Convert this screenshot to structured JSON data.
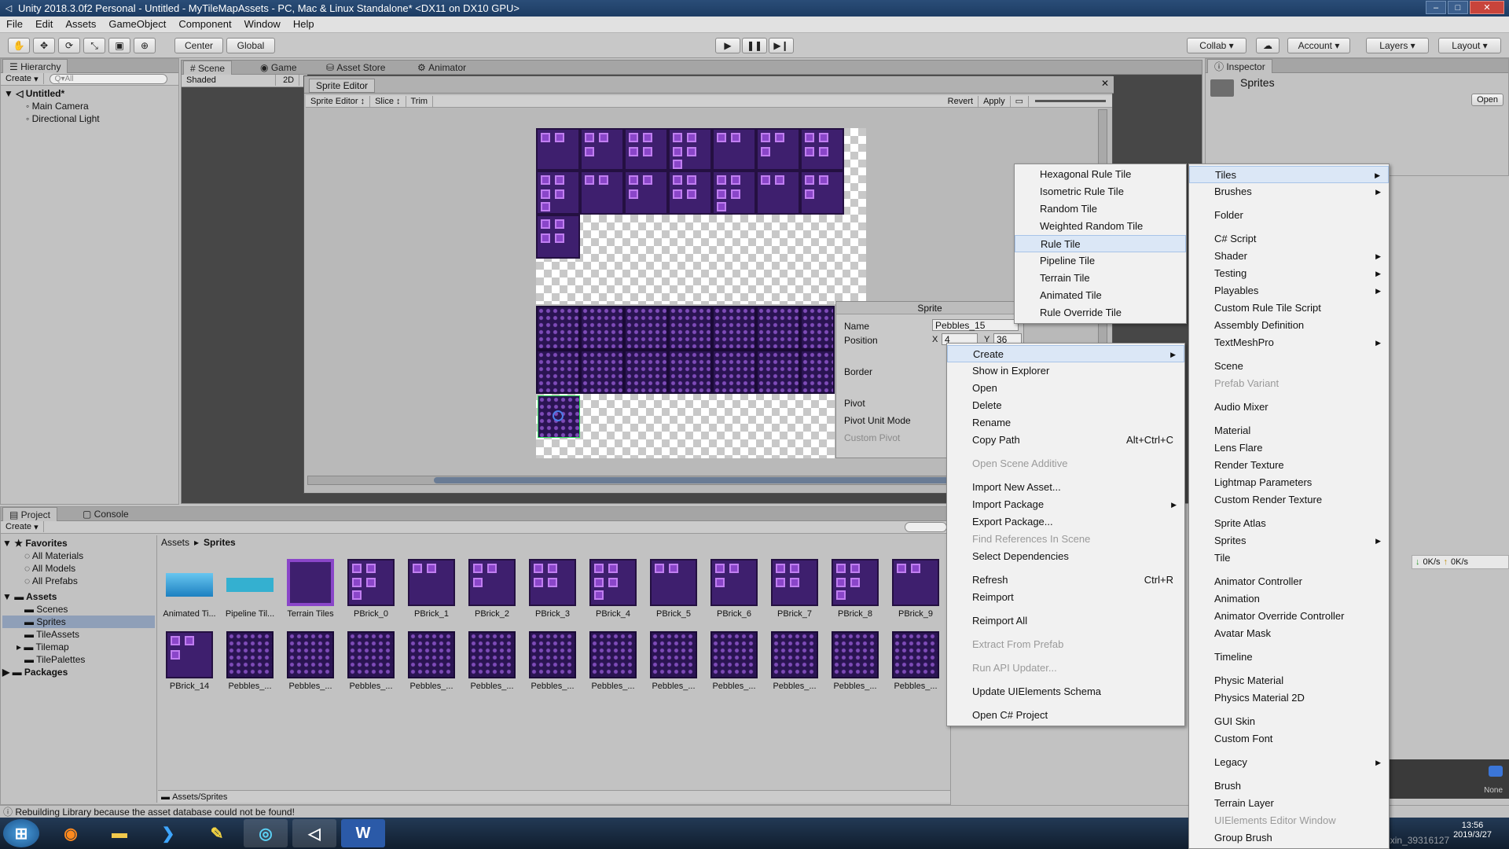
{
  "window": {
    "title": "Unity 2018.3.0f2 Personal - Untitled - MyTileMapAssets - PC, Mac & Linux Standalone* <DX11 on DX10 GPU>",
    "min": "–",
    "max": "□",
    "close": "✕"
  },
  "menubar": [
    "File",
    "Edit",
    "Assets",
    "GameObject",
    "Component",
    "Window",
    "Help"
  ],
  "toolbar": {
    "center": "Center",
    "global": "Global",
    "collab": "Collab",
    "account": "Account",
    "layers": "Layers",
    "layout": "Layout"
  },
  "hierarchy": {
    "tab": "Hierarchy",
    "create": "Create",
    "search": "Q▾All",
    "scene": "Untitled*",
    "items": [
      "Main Camera",
      "Directional Light"
    ]
  },
  "scene_tabs": [
    "Scene",
    "Game",
    "Asset Store",
    "Animator"
  ],
  "scene_bar": {
    "shaded": "Shaded",
    "mode": "2D"
  },
  "sprite_editor": {
    "title": "Sprite Editor",
    "mode": "Sprite Editor",
    "slice": "Slice",
    "trim": "Trim",
    "revert": "Revert",
    "apply": "Apply"
  },
  "sprite_panel": {
    "header": "Sprite",
    "name_label": "Name",
    "name_value": "Pebbles_15",
    "position_label": "Position",
    "x_label": "X",
    "x_value": "4",
    "y_label": "Y",
    "y_value": "36",
    "border_label": "Border",
    "pivot_label": "Pivot",
    "pivot_unit_label": "Pivot Unit Mode",
    "custom_pivot_label": "Custom Pivot"
  },
  "inspector": {
    "tab": "Inspector",
    "title": "Sprites",
    "open": "Open"
  },
  "project": {
    "tabs": [
      "Project",
      "Console"
    ],
    "create": "Create",
    "breadcrumb": [
      "Assets",
      "Sprites"
    ],
    "footer": "Assets/Sprites",
    "favorites": {
      "label": "Favorites",
      "items": [
        "All Materials",
        "All Models",
        "All Prefabs"
      ]
    },
    "assets": {
      "label": "Assets",
      "items": [
        "Scenes",
        "Sprites",
        "TileAssets",
        "Tilemap",
        "TilePalettes"
      ]
    },
    "packages": "Packages",
    "row1": [
      "Animated Ti...",
      "Pipeline Til...",
      "Terrain Tiles",
      "PBrick_0",
      "PBrick_1",
      "PBrick_2",
      "PBrick_3",
      "PBrick_4",
      "PBrick_5",
      "PBrick_6",
      "PBrick_7",
      "PBrick_8",
      "PBrick_9"
    ],
    "row2": [
      "PBrick_14",
      "Pebbles_...",
      "Pebbles_...",
      "Pebbles_...",
      "Pebbles_...",
      "Pebbles_...",
      "Pebbles_...",
      "Pebbles_...",
      "Pebbles_...",
      "Pebbles_...",
      "Pebbles_...",
      "Pebbles_...",
      "Pebbles_..."
    ]
  },
  "status": "Rebuilding Library because the asset database could not be found!",
  "context_menu": [
    {
      "label": "Create",
      "submenu": true,
      "highlight": true
    },
    {
      "label": "Show in Explorer"
    },
    {
      "label": "Open"
    },
    {
      "label": "Delete"
    },
    {
      "label": "Rename"
    },
    {
      "label": "Copy Path",
      "shortcut": "Alt+Ctrl+C"
    },
    {
      "sep": true
    },
    {
      "label": "Open Scene Additive",
      "disabled": true
    },
    {
      "sep": true
    },
    {
      "label": "Import New Asset..."
    },
    {
      "label": "Import Package",
      "submenu": true
    },
    {
      "label": "Export Package..."
    },
    {
      "label": "Find References In Scene",
      "disabled": true
    },
    {
      "label": "Select Dependencies"
    },
    {
      "sep": true
    },
    {
      "label": "Refresh",
      "shortcut": "Ctrl+R"
    },
    {
      "label": "Reimport"
    },
    {
      "sep": true
    },
    {
      "label": "Reimport All"
    },
    {
      "sep": true
    },
    {
      "label": "Extract From Prefab",
      "disabled": true
    },
    {
      "sep": true
    },
    {
      "label": "Run API Updater...",
      "disabled": true
    },
    {
      "sep": true
    },
    {
      "label": "Update UIElements Schema"
    },
    {
      "sep": true
    },
    {
      "label": "Open C# Project"
    }
  ],
  "create_menu": [
    {
      "label": "Tiles",
      "submenu": true,
      "highlight": true
    },
    {
      "label": "Brushes",
      "submenu": true
    },
    {
      "sep": true
    },
    {
      "label": "Folder"
    },
    {
      "sep": true
    },
    {
      "label": "C# Script"
    },
    {
      "label": "Shader",
      "submenu": true
    },
    {
      "label": "Testing",
      "submenu": true
    },
    {
      "label": "Playables",
      "submenu": true
    },
    {
      "label": "Custom Rule Tile Script"
    },
    {
      "label": "Assembly Definition"
    },
    {
      "label": "TextMeshPro",
      "submenu": true
    },
    {
      "sep": true
    },
    {
      "label": "Scene"
    },
    {
      "label": "Prefab Variant",
      "disabled": true
    },
    {
      "sep": true
    },
    {
      "label": "Audio Mixer"
    },
    {
      "sep": true
    },
    {
      "label": "Material"
    },
    {
      "label": "Lens Flare"
    },
    {
      "label": "Render Texture"
    },
    {
      "label": "Lightmap Parameters"
    },
    {
      "label": "Custom Render Texture"
    },
    {
      "sep": true
    },
    {
      "label": "Sprite Atlas"
    },
    {
      "label": "Sprites",
      "submenu": true
    },
    {
      "label": "Tile"
    },
    {
      "sep": true
    },
    {
      "label": "Animator Controller"
    },
    {
      "label": "Animation"
    },
    {
      "label": "Animator Override Controller"
    },
    {
      "label": "Avatar Mask"
    },
    {
      "sep": true
    },
    {
      "label": "Timeline"
    },
    {
      "sep": true
    },
    {
      "label": "Physic Material"
    },
    {
      "label": "Physics Material 2D"
    },
    {
      "sep": true
    },
    {
      "label": "GUI Skin"
    },
    {
      "label": "Custom Font"
    },
    {
      "sep": true
    },
    {
      "label": "Legacy",
      "submenu": true
    },
    {
      "sep": true
    },
    {
      "label": "Brush"
    },
    {
      "label": "Terrain Layer"
    },
    {
      "label": "UIElements Editor Window",
      "disabled": true
    },
    {
      "label": "Group Brush"
    }
  ],
  "tiles_menu": [
    {
      "label": "Hexagonal Rule Tile"
    },
    {
      "label": "Isometric Rule Tile"
    },
    {
      "label": "Random Tile"
    },
    {
      "label": "Weighted Random Tile"
    },
    {
      "label": "Rule Tile",
      "highlight": true
    },
    {
      "label": "Pipeline Tile"
    },
    {
      "label": "Terrain Tile"
    },
    {
      "label": "Animated Tile"
    },
    {
      "label": "Rule Override Tile"
    }
  ],
  "netspeed": {
    "down": "0K/s",
    "up": "0K/s"
  },
  "bottom_right": {
    "none": "None"
  },
  "taskbar": {
    "time": "13:56",
    "date": "2019/3/27",
    "watermark": "https://blog.csdn.net/weixin_39316127"
  }
}
